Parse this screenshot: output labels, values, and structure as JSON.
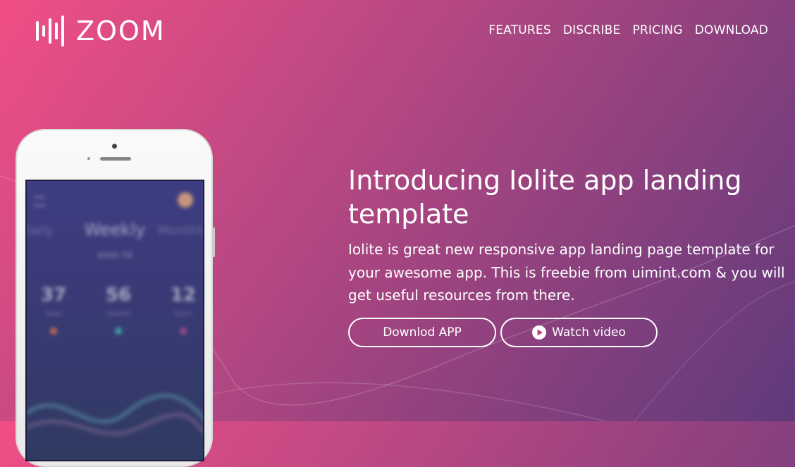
{
  "brand": {
    "name": "ZOOM",
    "logo_icon": "sound-bars-icon"
  },
  "nav": {
    "items": [
      {
        "label": "FEATURES"
      },
      {
        "label": "DISCRIBE"
      },
      {
        "label": "PRICING"
      },
      {
        "label": "DOWNLOAD"
      }
    ]
  },
  "hero": {
    "title": "Introducing Iolite app landing template",
    "text": "Iolite is great new responsive app landing page template for your awesome app. This is freebie from uimint.com & you will get useful resources from there.",
    "download_label": "Downlod APP",
    "video_label": "Watch video",
    "video_icon": "play-circle-icon"
  },
  "colors": {
    "gradient_start": "#f04e85",
    "gradient_end": "#5f3a7c",
    "text": "#ffffff"
  },
  "phone": {
    "screen_title": "Weekly",
    "side_left": "Daily",
    "side_right": "Monthly",
    "screen_subtitle": "week 04",
    "stats": [
      {
        "value": "37",
        "label": "steps",
        "dot": "#c56a56"
      },
      {
        "value": "56",
        "label": "calories",
        "dot": "#3fa7a0"
      },
      {
        "value": "12",
        "label": "hours",
        "dot": "#a04a8a"
      }
    ]
  }
}
